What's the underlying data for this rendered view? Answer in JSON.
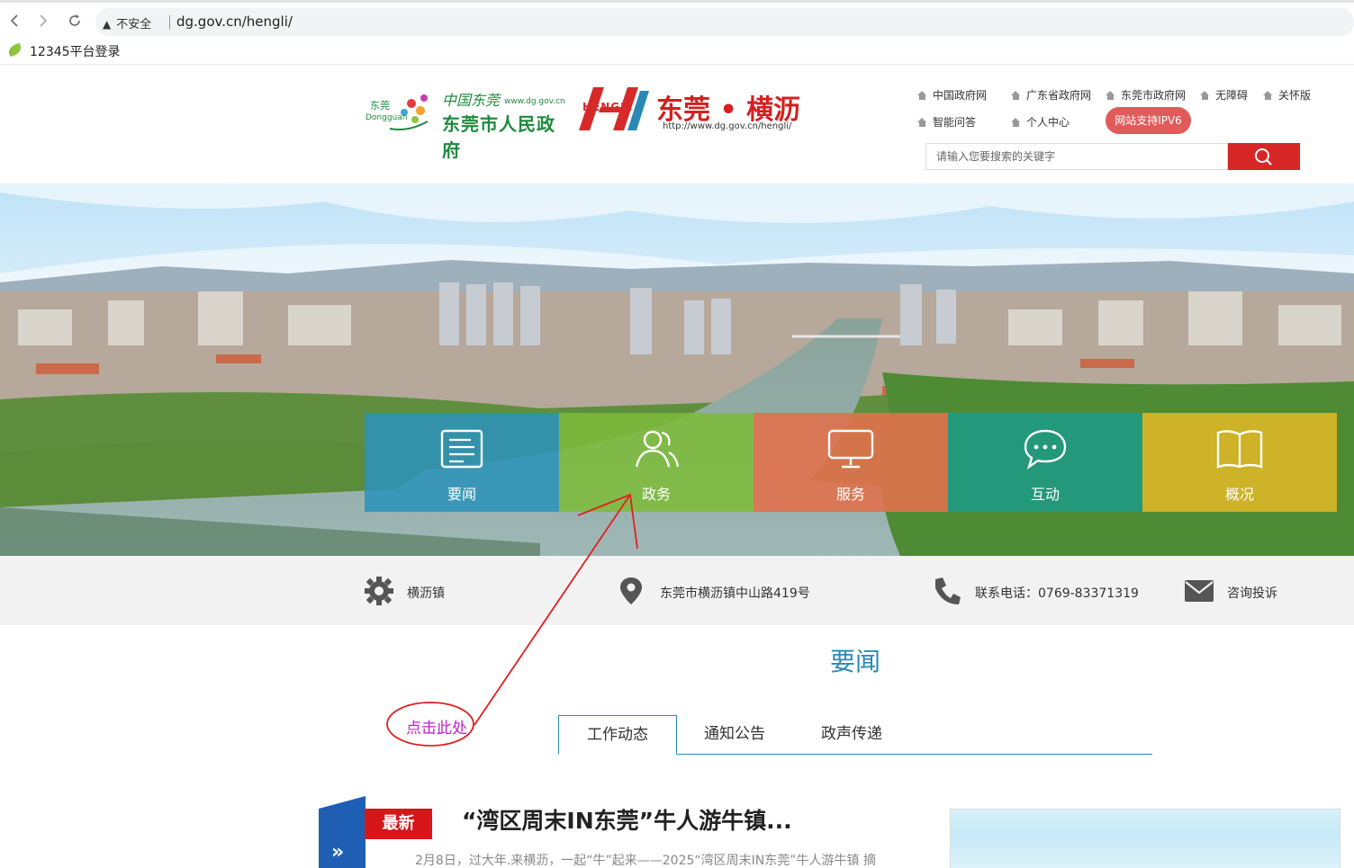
{
  "browser": {
    "back_icon": "back-arrow-icon",
    "forward_icon": "forward-arrow-icon",
    "reload_icon": "reload-icon",
    "security_label": "不安全",
    "url": "dg.gov.cn/hengli/",
    "bookmark_label": "12345平台登录"
  },
  "header": {
    "logo_dg": {
      "brand_small": "东莞",
      "brand_en": "Dongguan",
      "line1": "中国东莞",
      "url": "www.dg.gov.cn",
      "line2": "东莞市人民政府"
    },
    "logo_hengli": {
      "mark_text": "HENGLI",
      "title": "东莞 • 横沥",
      "url": "http://www.dg.gov.cn/hengli/"
    },
    "top_links": [
      "中国政府网",
      "广东省政府网",
      "东莞市政府网",
      "无障碍",
      "关怀版",
      "智能问答",
      "个人中心"
    ],
    "ipv6_label": "网站支持IPV6",
    "search_placeholder": "请输入您要搜索的关键字",
    "search_icon": "search-icon"
  },
  "nav_tiles": [
    {
      "label": "要闻",
      "icon": "news-icon",
      "color": "#2e93b8"
    },
    {
      "label": "政务",
      "icon": "users-icon",
      "color": "#7dbb3a"
    },
    {
      "label": "服务",
      "icon": "monitor-icon",
      "color": "#e0714d"
    },
    {
      "label": "互动",
      "icon": "chat-icon",
      "color": "#1f9a85"
    },
    {
      "label": "概况",
      "icon": "book-icon",
      "color": "#dcb626"
    }
  ],
  "info_bar": {
    "town": "横沥镇",
    "address": "东莞市横沥镇中山路419号",
    "phone": "联系电话：0769-83371319",
    "complaint": "咨询投诉"
  },
  "news": {
    "section_title": "要闻",
    "tabs": [
      "工作动态",
      "通知公告",
      "政声传递"
    ],
    "active_tab": "工作动态",
    "latest_badge": "最新",
    "headline": "“湾区周末IN东莞”牛人游牛镇...",
    "summary": "2月8日，过大年.来横沥，一起“牛”起来——2025“湾区周末IN东莞”牛人游牛镇 摘"
  },
  "annotation": {
    "label": "点击此处",
    "color": "#e02020"
  }
}
